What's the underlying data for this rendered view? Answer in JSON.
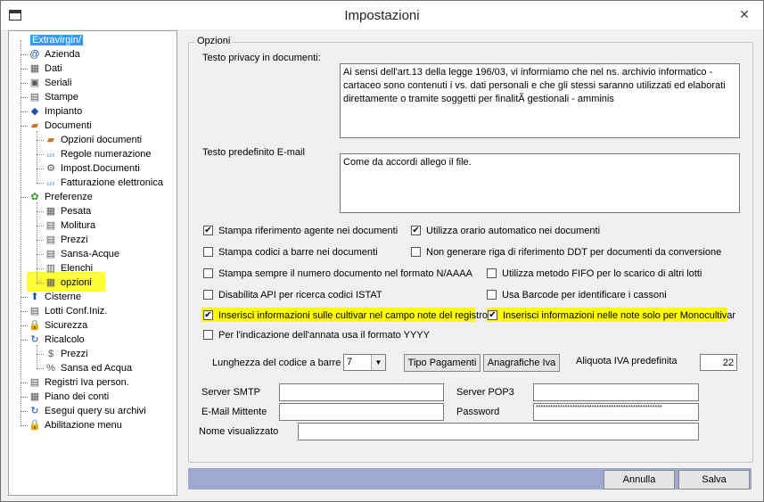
{
  "window": {
    "title": "Impostazioni",
    "close_glyph": "✕"
  },
  "tree": {
    "root": "Extravirgin/",
    "nodes": [
      {
        "label": "Azienda",
        "icon": "at-icon"
      },
      {
        "label": "Dati",
        "icon": "data-icon"
      },
      {
        "label": "Seriali",
        "icon": "seriali-icon"
      },
      {
        "label": "Stampe",
        "icon": "printer-icon"
      },
      {
        "label": "Impianto",
        "icon": "impianto-icon"
      },
      {
        "label": "Documenti",
        "icon": "folder-icon"
      },
      {
        "label": "Opzioni documenti",
        "icon": "folder-icon"
      },
      {
        "label": "Regole numerazione",
        "icon": "numbering-icon"
      },
      {
        "label": "Impost.Documenti",
        "icon": "settings-doc-icon"
      },
      {
        "label": "Fatturazione elettronica",
        "icon": "numbering-icon"
      },
      {
        "label": "Preferenze",
        "icon": "preferences-icon"
      },
      {
        "label": "Pesata",
        "icon": "calendar-icon"
      },
      {
        "label": "Molitura",
        "icon": "doc-icon"
      },
      {
        "label": "Prezzi",
        "icon": "doc-icon"
      },
      {
        "label": "Sansa-Acque",
        "icon": "doc-icon"
      },
      {
        "label": "Elenchi",
        "icon": "list-icon"
      },
      {
        "label": "opzioni",
        "icon": "grid-icon"
      },
      {
        "label": "Cisterne",
        "icon": "tank-icon"
      },
      {
        "label": "Lotti Conf.Iniz.",
        "icon": "doc-icon"
      },
      {
        "label": "Sicurezza",
        "icon": "lock-icon"
      },
      {
        "label": "Ricalcolo",
        "icon": "refresh-icon"
      },
      {
        "label": "Prezzi",
        "icon": "money-icon"
      },
      {
        "label": "Sansa ed Acqua",
        "icon": "percent-icon"
      },
      {
        "label": "Registri Iva person.",
        "icon": "doc-icon"
      },
      {
        "label": "Piano dei conti",
        "icon": "grid-icon"
      },
      {
        "label": "Esegui query su archivi",
        "icon": "refresh-icon"
      },
      {
        "label": "Abilitazione menu",
        "icon": "lock-icon"
      }
    ]
  },
  "options": {
    "legend": "Opzioni",
    "privacy_label": "Testo privacy in documenti:",
    "privacy_text": "Ai sensi dell'art.13 della legge 196/03, vi informiamo che nel ns. archivio informatico - cartaceo sono contenuti i vs. dati personali e che gli stessi saranno utilizzati ed elaborati direttamente o tramite soggetti per finalitÃ  gestionali - amminis",
    "email_label": "Testo predefinito E-mail",
    "email_text": "Come da accordi allego il file.",
    "checkboxes": [
      {
        "label": "Stampa riferimento agente nei documenti",
        "checked": true
      },
      {
        "label": "Utilizza orario automatico nei documenti",
        "checked": true
      },
      {
        "label": "Stampa codici a barre nei documenti",
        "checked": false
      },
      {
        "label": "Non generare riga di riferimento DDT per documenti da conversione",
        "checked": false
      },
      {
        "label": "Stampa sempre il numero documento nel formato N/AAAA",
        "checked": false
      },
      {
        "label": "Utilizza metodo FIFO per lo scarico di altri lotti",
        "checked": false
      },
      {
        "label": "Disabilita API per ricerca codici ISTAT",
        "checked": false
      },
      {
        "label": "Usa Barcode per identificare i cassoni",
        "checked": false
      },
      {
        "label": "Inserisci informazioni sulle cultivar nel campo note del registro",
        "checked": true
      },
      {
        "label": "Inserisci informazioni nelle note solo per Monocultivar",
        "checked": true
      },
      {
        "label": "Per l'indicazione dell'annata usa il formato YYYY",
        "checked": false
      }
    ],
    "barcode_length_label": "Lunghezza del codice a barre",
    "barcode_length_value": "7",
    "tipo_pagamenti_button": "Tipo Pagamenti",
    "anagrafiche_iva_button": "Anagrafiche Iva",
    "aliquota_label": "Aliquota IVA predefinita",
    "aliquota_value": "22",
    "smtp_label": "Server SMTP",
    "smtp_value": "",
    "pop3_label": "Server POP3",
    "pop3_value": "",
    "mittente_label": "E-Mail Mittente",
    "mittente_value": "",
    "password_label": "Password",
    "password_value": "****************************************************",
    "display_name_label": "Nome visualizzato",
    "display_name_value": ""
  },
  "footer": {
    "cancel": "Annulla",
    "save": "Salva"
  },
  "colors": {
    "selection": "#3399ff",
    "highlight": "#ffff00",
    "bottombar": "#9fa8cf"
  }
}
